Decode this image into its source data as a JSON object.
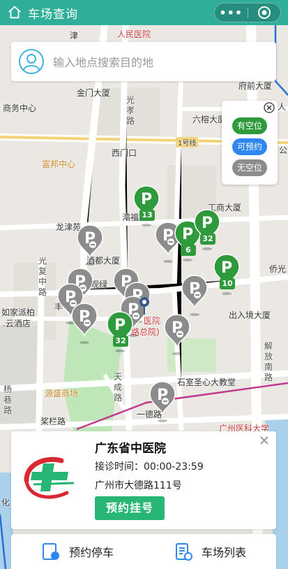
{
  "header": {
    "title": "车场查询",
    "more_label": "•••"
  },
  "search": {
    "placeholder": "输入地点搜索目的地"
  },
  "legend": {
    "items": [
      {
        "label": "有空位",
        "color": "#2f9a3c"
      },
      {
        "label": "可预约",
        "color": "#2f86ee"
      },
      {
        "label": "无空位",
        "color": "#8c8c8c"
      }
    ]
  },
  "map": {
    "labels": {
      "jin": "津",
      "renmin_hospital": "人民医院",
      "fuqian_building": "府前大厦",
      "ren": "人",
      "jinmen_building": "金门大厦",
      "guangxiao": "光孝路",
      "commerce_center": "商务中心",
      "liurong_building": "六榕大厦",
      "xmk": "西门口",
      "metro1": "1号线",
      "gong": "公",
      "fubang": "富邦中心",
      "hongfu": "鸿福厦",
      "gongshang": "工商大厦",
      "longjin": "龙津苑",
      "jiudu": "酒都大厦",
      "guanglu": "观绿",
      "guangfu": "光复中路",
      "qiaoguang": "侨光",
      "rujia": "如家派柏",
      "yunjiudian": ".云酒店",
      "feng": "丰",
      "hospital_a": "医院",
      "hospital_b": "路总院)",
      "churujing": "出入境大厦",
      "jiefang": "解放南路",
      "tiancheng": "天成路",
      "shishi": "石室圣心大教堂",
      "yangxiang": "杨巷路",
      "yuansheng": "源盛商场",
      "jianlan": "桨栏路",
      "yide": "一德路",
      "gzmu": "广州医科大学",
      "hua": "化"
    }
  },
  "markers": [
    {
      "status": "available",
      "count": "13"
    },
    {
      "status": "full"
    },
    {
      "status": "available",
      "count": "6"
    },
    {
      "status": "available",
      "count": "32"
    },
    {
      "status": "available",
      "count": "10"
    },
    {
      "status": "full"
    },
    {
      "status": "full"
    },
    {
      "status": "full"
    },
    {
      "status": "full"
    },
    {
      "status": "full"
    },
    {
      "status": "full"
    },
    {
      "status": "full"
    },
    {
      "status": "available",
      "count": "32"
    },
    {
      "status": "full"
    },
    {
      "status": "full"
    },
    {
      "status": "full"
    }
  ],
  "card": {
    "name": "广东省中医院",
    "hours": "接诊时间：00:00-23:59",
    "address": "广州市大德路111号",
    "book_label": "预约挂号",
    "brand_green": "#27b673",
    "logo_red": "#d9282f"
  },
  "bottom_nav": {
    "reserve_label": "预约停车",
    "list_label": "车场列表",
    "icon_color": "#2f86ee"
  },
  "colors": {
    "header": "#2fae9a",
    "available": "#2f9a3c",
    "full": "#8c8c8c"
  }
}
